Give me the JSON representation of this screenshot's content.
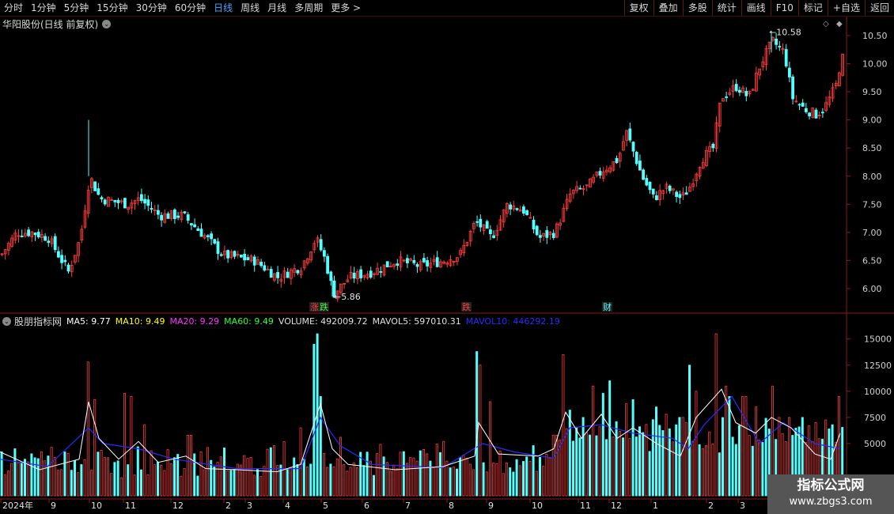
{
  "toolbar": {
    "periods": [
      "分时",
      "1分钟",
      "5分钟",
      "15分钟",
      "30分钟",
      "60分钟",
      "日线",
      "周线",
      "月线",
      "多周期",
      "更多 >"
    ],
    "active_period": "日线",
    "buttons": [
      "复权",
      "叠加",
      "多股",
      "统计",
      "画线",
      "F10",
      "标记",
      "+自选",
      "返回"
    ]
  },
  "main": {
    "stock_title": "华阳股份(日线 前复权)",
    "y_ticks": [
      "10.50",
      "10.00",
      "9.50",
      "9.00",
      "8.50",
      "8.00",
      "7.50",
      "7.00",
      "6.50",
      "6.00"
    ],
    "high_label": "10.58",
    "low_label": "5.86",
    "markers": {
      "m1": "涨",
      "m2": "跌",
      "m3": "跌",
      "m4": "财"
    },
    "colors": {
      "up": "#ff3c3c",
      "down": "#54ffff",
      "background": "#000000"
    }
  },
  "indicator": {
    "name": "股朋指标网",
    "ma5": "MA5: 9.77",
    "ma10": "MA10: 9.49",
    "ma20": "MA20: 9.29",
    "ma60": "MA60: 9.49",
    "volume": "VOLUME: 492009.72",
    "mavol5": "MAVOL5: 597010.31",
    "mavol10": "MAVOL10: 446292.19",
    "y_ticks": [
      "15000",
      "12500",
      "10000",
      "7500",
      "5000"
    ],
    "colors": {
      "ma5": "#ffffff",
      "ma10": "#ffff00",
      "ma20": "#ff33ff",
      "ma60": "#33ff33",
      "mavol10": "#2b2bff"
    }
  },
  "x_axis": {
    "labels": [
      "2024年",
      "9",
      "10",
      "11",
      "12",
      "2",
      "3",
      "4",
      "5",
      "6",
      "7",
      "8",
      "9",
      "10",
      "11",
      "12",
      "1",
      "2",
      "3"
    ]
  },
  "watermark": {
    "line1": "指标公式网",
    "line2": "www.zbgs3.com"
  }
}
